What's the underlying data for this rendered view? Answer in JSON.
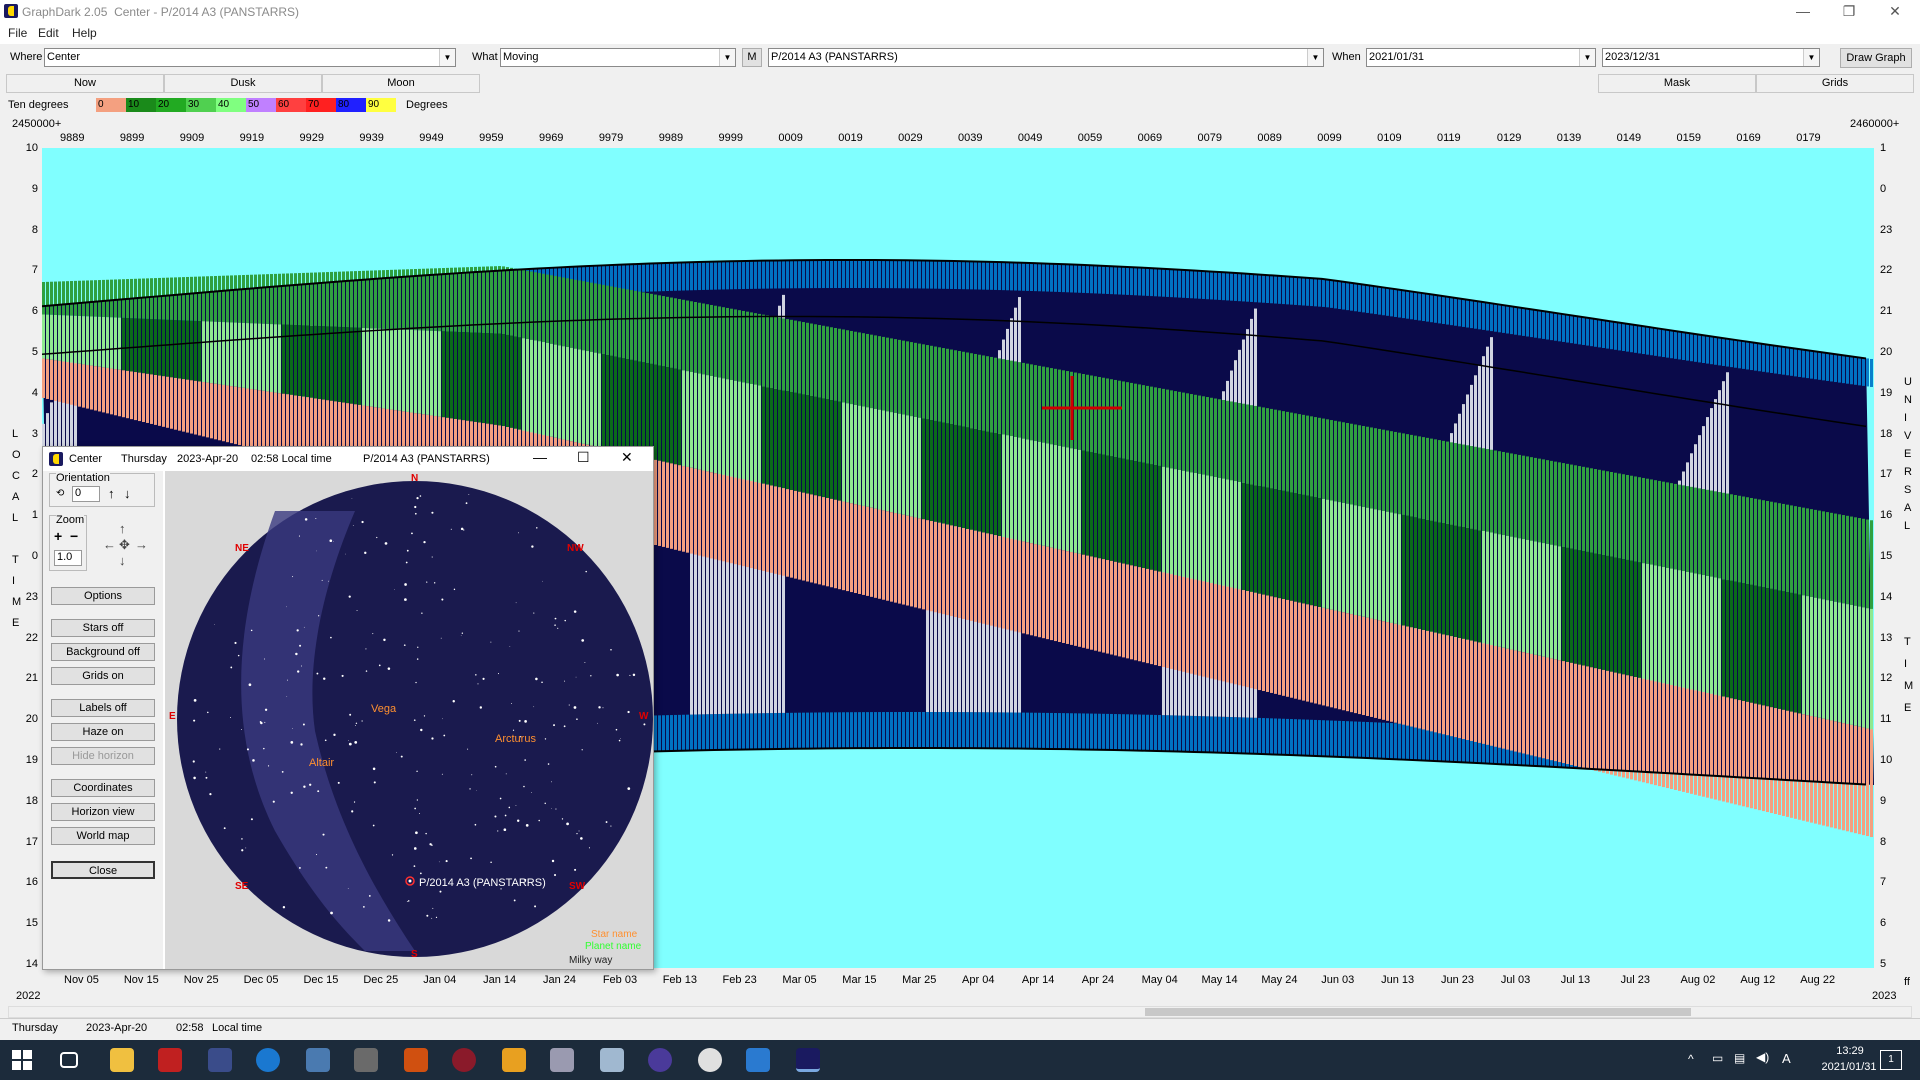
{
  "window": {
    "app": "GraphDark 2.05",
    "title_extra": "Center  -  P/2014 A3 (PANSTARRS)",
    "minimize": "—",
    "restore": "❐",
    "close": "✕"
  },
  "menu": [
    "File",
    "Edit",
    "Help"
  ],
  "toolbar": {
    "where_label": "Where",
    "where_value": "Center",
    "what_label": "What",
    "what_value": "Moving",
    "m_button": "M",
    "object_value": "P/2014 A3 (PANSTARRS)",
    "when_label": "When",
    "when_from": "2021/01/31",
    "when_to": "2023/12/31",
    "draw_button": "Draw Graph"
  },
  "tabs": {
    "now": "Now",
    "dusk": "Dusk",
    "moon": "Moon",
    "mask": "Mask",
    "grids": "Grids"
  },
  "legend": {
    "left_label": "Ten degrees",
    "right_label": "Degrees",
    "ticks": [
      "0",
      "10",
      "20",
      "30",
      "40",
      "50",
      "60",
      "70",
      "80",
      "90"
    ],
    "colors": [
      "#f4a080",
      "#1a8a1a",
      "#22aa22",
      "#50d050",
      "#80ff80",
      "#c080ff",
      "#ff4040",
      "#ff2020",
      "#2020ff",
      "#ffff40"
    ]
  },
  "plot": {
    "top_left_jd": "2450000+",
    "top_right_jd": "2460000+",
    "jd_ticks": [
      "9889",
      "9899",
      "9909",
      "9919",
      "9929",
      "9939",
      "9949",
      "9959",
      "9969",
      "9979",
      "9989",
      "9999",
      "0009",
      "0019",
      "0029",
      "0039",
      "0049",
      "0059",
      "0069",
      "0079",
      "0089",
      "0099",
      "0109",
      "0119",
      "0129",
      "0139",
      "0149",
      "0159",
      "0169",
      "0179"
    ],
    "date_ticks": [
      "Nov 05",
      "Nov 15",
      "Nov 25",
      "Dec 05",
      "Dec 15",
      "Dec 25",
      "Jan 04",
      "Jan 14",
      "Jan 24",
      "Feb 03",
      "Feb 13",
      "Feb 23",
      "Mar 05",
      "Mar 15",
      "Mar 25",
      "Apr 04",
      "Apr 14",
      "Apr 24",
      "May 04",
      "May 14",
      "May 24",
      "Jun 03",
      "Jun 13",
      "Jun 23",
      "Jul 03",
      "Jul 13",
      "Jul 23",
      "Aug 02",
      "Aug 12",
      "Aug 22"
    ],
    "year_left": "2022",
    "year_right": "2023",
    "left_axis": [
      "10",
      "9",
      "8",
      "7",
      "6",
      "5",
      "4",
      "3",
      "2",
      "1",
      "0",
      "23",
      "22",
      "21",
      "20",
      "19",
      "18",
      "17",
      "16",
      "15",
      "14"
    ],
    "right_axis": [
      "1",
      "0",
      "23",
      "22",
      "21",
      "20",
      "19",
      "18",
      "17",
      "16",
      "15",
      "14",
      "13",
      "12",
      "11",
      "10",
      "9",
      "8",
      "7",
      "6",
      "5"
    ],
    "left_title": [
      "L",
      "O",
      "C",
      "A",
      "L",
      "",
      "T",
      "I",
      "M",
      "E"
    ],
    "right_title_top": [
      "U",
      "N",
      "I",
      "V",
      "E",
      "R",
      "S",
      "A",
      "L"
    ],
    "right_title_bottom": [
      "T",
      "I",
      "M",
      "E"
    ],
    "right_corner": "ff",
    "colors": {
      "sky": "#80ffff",
      "night": "#0a0a4a",
      "twilight": "#0078c8",
      "moonlight": "#d0d4e0",
      "salmon": "#f4a080",
      "dark_green": "#0a6a1a",
      "mid_green": "#30a040",
      "light_green": "#90e890",
      "cursor": "#d00000"
    }
  },
  "status": {
    "day": "Thursday",
    "date": "2023-Apr-20",
    "time": "02:58",
    "tz": "Local time"
  },
  "sky_window": {
    "title_place": "Center",
    "title_day": "Thursday",
    "title_date": "2023-Apr-20",
    "title_time": "02:58 Local time",
    "title_object": "P/2014 A3 (PANSTARRS)",
    "orientation_label": "Orientation",
    "orientation_value": "0",
    "zoom_label": "Zoom",
    "zoom_value": "1.0",
    "buttons": [
      "Options",
      "Stars off",
      "Background off",
      "Grids on",
      "Labels off",
      "Haze on",
      "Hide horizon",
      "Coordinates",
      "Horizon view",
      "World map",
      "Close"
    ],
    "compass": {
      "n": "N",
      "ne": "NE",
      "nw": "NW",
      "e": "E",
      "w": "W",
      "se": "SE",
      "sw": "SW",
      "s": "S"
    },
    "stars": {
      "vega": "Vega",
      "arcturus": "Arcturus",
      "altair": "Altair"
    },
    "target_label": "P/2014 A3 (PANSTARRS)",
    "legend_star": "Star name",
    "legend_planet": "Planet name",
    "legend_milky": "Milky way"
  },
  "taskbar": {
    "time": "13:29",
    "date": "2021/01/31",
    "lang": "A",
    "notif": "1"
  }
}
